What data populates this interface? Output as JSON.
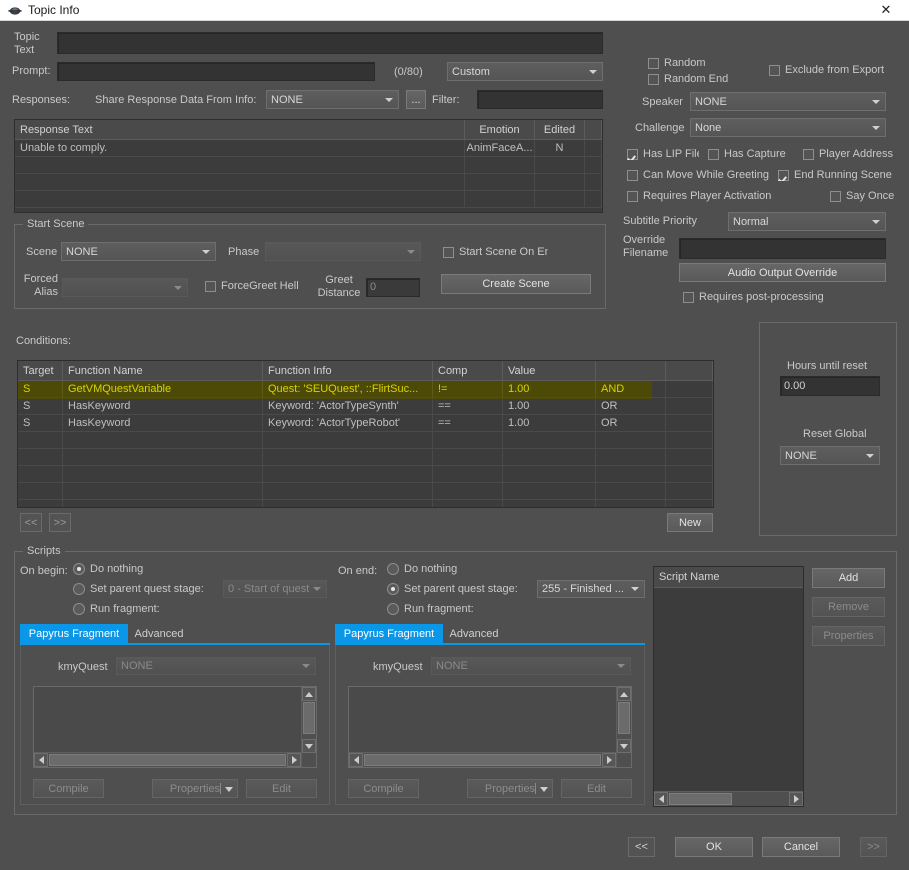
{
  "window": {
    "title": "Topic Info",
    "close_label": "✕",
    "icon": "gear-icon"
  },
  "topic": {
    "topic_text_label": "Topic\nText",
    "topic_text_value": "",
    "prompt_label": "Prompt:",
    "prompt_value": "",
    "prompt_counter": "(0/80)",
    "prompt_type": "Custom",
    "responses_label": "Responses:",
    "share_label": "Share Response Data From Info:",
    "share_value": "NONE",
    "browse_label": "...",
    "filter_label": "Filter:",
    "filter_value": ""
  },
  "responses_table": {
    "columns": [
      "Response Text",
      "Emotion",
      "Edited",
      ""
    ],
    "rows": [
      {
        "text": "Unable to comply.",
        "emotion": "AnimFaceA...",
        "edited": "N"
      },
      {
        "text": "",
        "emotion": "",
        "edited": ""
      },
      {
        "text": "",
        "emotion": "",
        "edited": ""
      },
      {
        "text": "",
        "emotion": "",
        "edited": ""
      },
      {
        "text": "",
        "emotion": "",
        "edited": ""
      }
    ]
  },
  "flags": {
    "random": {
      "label": "Random",
      "checked": false
    },
    "random_end": {
      "label": "Random End",
      "checked": false
    },
    "exclude_from_export": {
      "label": "Exclude from Export",
      "checked": false
    },
    "speaker_label": "Speaker",
    "speaker_value": "NONE",
    "challenge_label": "Challenge",
    "challenge_value": "None",
    "has_lip_file": {
      "label": "Has LIP File",
      "checked": true
    },
    "has_capture": {
      "label": "Has Capture",
      "checked": false
    },
    "player_address": {
      "label": "Player Address",
      "checked": false
    },
    "can_move_while_greeting": {
      "label": "Can Move While Greeting",
      "checked": false
    },
    "end_running_scene": {
      "label": "End Running Scene",
      "checked": true
    },
    "requires_player_activation": {
      "label": "Requires Player Activation",
      "checked": false
    },
    "say_once": {
      "label": "Say Once",
      "checked": false
    },
    "subtitle_priority_label": "Subtitle Priority",
    "subtitle_priority_value": "Normal",
    "override_filename_label": "Override\nFilename",
    "override_filename_value": "",
    "audio_output_override": "Audio Output Override",
    "requires_post_processing": {
      "label": "Requires post-processing",
      "checked": false
    }
  },
  "start_scene": {
    "group_title": "Start Scene",
    "scene_label": "Scene",
    "scene_value": "NONE",
    "phase_label": "Phase",
    "phase_value": "",
    "start_scene_on_end": {
      "label": "Start Scene On End",
      "checked": false
    },
    "forced_alias_label": "Forced\nAlias",
    "forced_alias_value": "",
    "force_greet_hello": {
      "label": "ForceGreet Hello",
      "checked": false
    },
    "greet_distance_label": "Greet\nDistance",
    "greet_distance_value": "0",
    "create_scene_label": "Create Scene"
  },
  "conditions": {
    "label": "Conditions:",
    "columns": [
      "Target",
      "Function Name",
      "Function Info",
      "Comp",
      "Value",
      "",
      ""
    ],
    "rows": [
      {
        "target": "S",
        "function_name": "GetVMQuestVariable",
        "function_info": "Quest: 'SEUQuest', ::FlirtSuc...",
        "comp": "!=",
        "value": "1.00",
        "logic": "AND",
        "selected": true
      },
      {
        "target": "S",
        "function_name": "HasKeyword",
        "function_info": "Keyword: 'ActorTypeSynth'",
        "comp": "==",
        "value": "1.00",
        "logic": "OR",
        "selected": false
      },
      {
        "target": "S",
        "function_name": "HasKeyword",
        "function_info": "Keyword: 'ActorTypeRobot'",
        "comp": "==",
        "value": "1.00",
        "logic": "OR",
        "selected": false
      },
      {
        "target": "",
        "function_name": "",
        "function_info": "",
        "comp": "",
        "value": "",
        "logic": "",
        "selected": false
      },
      {
        "target": "",
        "function_name": "",
        "function_info": "",
        "comp": "",
        "value": "",
        "logic": "",
        "selected": false
      },
      {
        "target": "",
        "function_name": "",
        "function_info": "",
        "comp": "",
        "value": "",
        "logic": "",
        "selected": false
      },
      {
        "target": "",
        "function_name": "",
        "function_info": "",
        "comp": "",
        "value": "",
        "logic": "",
        "selected": false
      },
      {
        "target": "",
        "function_name": "",
        "function_info": "",
        "comp": "",
        "value": "",
        "logic": "",
        "selected": false
      }
    ],
    "prev_label": "<<",
    "next_label": ">>",
    "new_label": "New"
  },
  "reset_panel": {
    "hours_label": "Hours until reset",
    "hours_value": "0.00",
    "reset_global_label": "Reset Global",
    "reset_global_value": "NONE"
  },
  "scripts": {
    "group_title": "Scripts",
    "on_begin_label": "On begin:",
    "on_begin_options": [
      "Do nothing",
      "Set parent quest stage:",
      "Run fragment:"
    ],
    "on_begin_selected": 0,
    "on_begin_stage_value": "0 - Start of quest",
    "on_end_label": "On end:",
    "on_end_options": [
      "Do nothing",
      "Set parent quest stage:",
      "Run fragment:"
    ],
    "on_end_selected": 1,
    "on_end_stage_value": "255 - Finished ...",
    "left_panel": {
      "tabs": [
        "Papyrus Fragment",
        "Advanced"
      ],
      "active_tab": 0,
      "kmyquest_label": "kmyQuest",
      "kmyquest_value": "NONE",
      "fragment_text": "",
      "compile_label": "Compile",
      "properties_label": "Properties",
      "edit_label": "Edit"
    },
    "right_panel": {
      "tabs": [
        "Papyrus Fragment",
        "Advanced"
      ],
      "active_tab": 0,
      "kmyquest_label": "kmyQuest",
      "kmyquest_value": "NONE",
      "fragment_text": "",
      "compile_label": "Compile",
      "properties_label": "Properties",
      "edit_label": "Edit"
    },
    "script_list": {
      "header": "Script Name",
      "rows": []
    },
    "add_label": "Add",
    "remove_label": "Remove",
    "properties_label": "Properties"
  },
  "footer": {
    "prev_label": "<<",
    "ok_label": "OK",
    "cancel_label": "Cancel",
    "next_label": ">>"
  },
  "colors": {
    "window_bg": "#4f4f4f",
    "accent_tab": "#0b97e8",
    "selection_bg": "#4d4a08",
    "selection_text": "#d8d200",
    "field_bg": "#333333"
  }
}
